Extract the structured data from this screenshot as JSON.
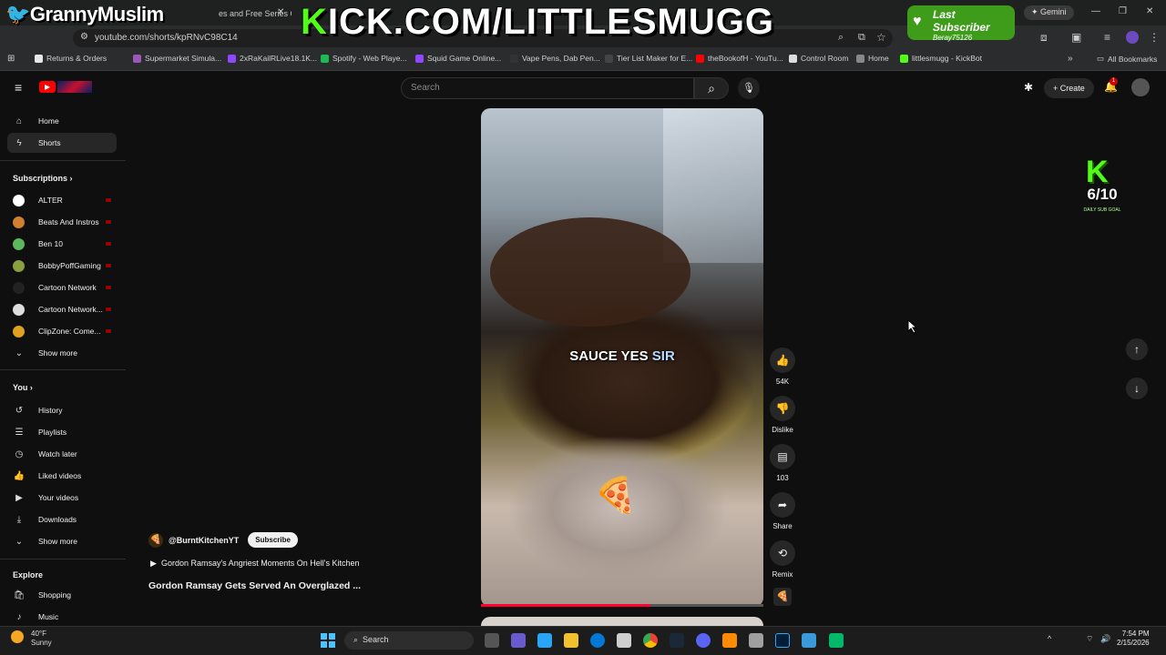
{
  "browser": {
    "tab_title": "es and Free Series On",
    "url": "youtube.com/shorts/kpRNvC98C14",
    "gemini_label": "Gemini",
    "bookmarks": [
      {
        "label": "Returns & Orders",
        "color": "#e7e7e7"
      },
      {
        "label": "Supermarket Simula...",
        "color": "#9b59b6"
      },
      {
        "label": "2xRaKailRLive18.1K...",
        "color": "#9146ff"
      },
      {
        "label": "Spotify - Web Playe...",
        "color": "#1db954"
      },
      {
        "label": "Squid Game Online...",
        "color": "#9146ff"
      },
      {
        "label": "Vape Pens, Dab Pen...",
        "color": "#333333"
      },
      {
        "label": "Tier List Maker for E...",
        "color": "#444444"
      },
      {
        "label": "theBookofH - YouTu...",
        "color": "#ff0000"
      },
      {
        "label": "Control Room",
        "color": "#dddddd"
      },
      {
        "label": "Home",
        "color": "#888888"
      },
      {
        "label": "littlesmugg - KickBot",
        "color": "#53fc18"
      }
    ],
    "all_bookmarks": "All Bookmarks"
  },
  "overlay": {
    "brand": "GrannyMuslim",
    "kick_k": "K",
    "kick_rest": "ICK.COM/LITTLESMUGG",
    "last_subscriber_label": "Last Subscriber",
    "last_subscriber_name": "Beray75126",
    "goal_count": "6/10",
    "goal_tag": "DAILY SUB GOAL",
    "goal_k": "K"
  },
  "header": {
    "search_placeholder": "Search",
    "create_label": "Create",
    "notification_count": "1"
  },
  "sidebar": {
    "main": [
      {
        "label": "Home",
        "icon": "home-icon",
        "glyph": "⌂"
      },
      {
        "label": "Shorts",
        "icon": "shorts-icon",
        "glyph": "ϟ"
      }
    ],
    "subscriptions_title": "Subscriptions",
    "subscriptions": [
      {
        "label": "ALTER",
        "color": "#ffffff"
      },
      {
        "label": "Beats And Instros",
        "color": "#d08030"
      },
      {
        "label": "Ben 10",
        "color": "#5cb85c"
      },
      {
        "label": "BobbyPoffGaming",
        "color": "#8aa040"
      },
      {
        "label": "Cartoon Network",
        "color": "#222222"
      },
      {
        "label": "Cartoon Network...",
        "color": "#dddddd"
      },
      {
        "label": "ClipZone: Come...",
        "color": "#e0a020"
      }
    ],
    "show_more_1": "Show more",
    "you_title": "You",
    "you": [
      {
        "label": "History",
        "glyph": "↺"
      },
      {
        "label": "Playlists",
        "glyph": "☰"
      },
      {
        "label": "Watch later",
        "glyph": "◷"
      },
      {
        "label": "Liked videos",
        "glyph": "👍"
      },
      {
        "label": "Your videos",
        "glyph": "▶"
      },
      {
        "label": "Downloads",
        "glyph": "⤓"
      }
    ],
    "show_more_2": "Show more",
    "explore_title": "Explore",
    "explore": [
      {
        "label": "Shopping",
        "glyph": "🛍"
      },
      {
        "label": "Music",
        "glyph": "♪"
      }
    ]
  },
  "short": {
    "caption_main": "SAUCE YES ",
    "caption_hl": "SIR",
    "channel": "@BurntKitchenYT",
    "subscribe_label": "Subscribe",
    "playlist": "Gordon Ramsay's Angriest Moments On Hell's Kitchen",
    "title": "Gordon Ramsay Gets Served An Overglazed ...",
    "progress": 0.6,
    "actions": {
      "like_count": "54K",
      "dislike_label": "Dislike",
      "comment_count": "103",
      "share_label": "Share",
      "remix_label": "Remix"
    }
  },
  "taskbar": {
    "search_label": "Search",
    "weather_temp": "40°F",
    "weather_desc": "Sunny",
    "time": "7:54 PM",
    "date": "2/15/2026"
  },
  "colors": {
    "background": "#0f0f0f",
    "youtube_red": "#ff0000",
    "kick_green": "#53fc18"
  }
}
